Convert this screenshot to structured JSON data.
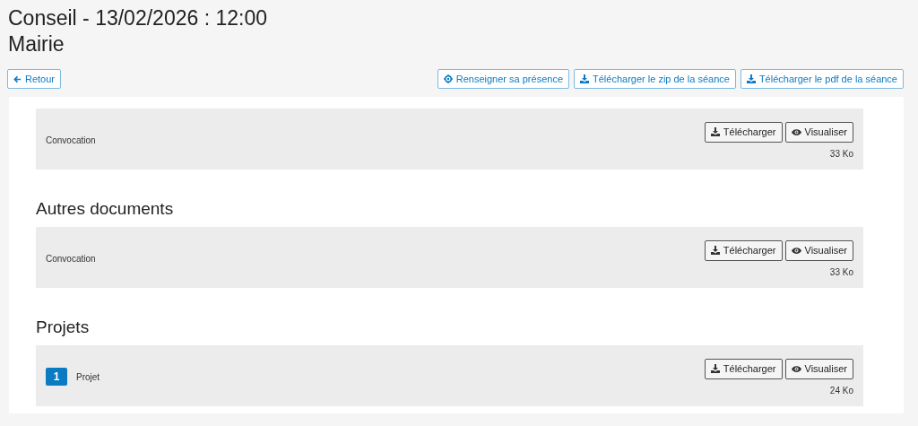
{
  "title": "Conseil - 13/02/2026 : 12:00",
  "subtitle": "Mairie",
  "back_button": "Retour",
  "actions": [
    {
      "kind": "presence",
      "label": "Renseigner sa présence"
    },
    {
      "kind": "download",
      "label": "Télécharger le zip de la séance"
    },
    {
      "kind": "download",
      "label": "Télécharger le pdf de la séance"
    }
  ],
  "sections": [
    {
      "documents": [
        {
          "name": "Convocation",
          "size": "33 Ko",
          "download": "Télécharger",
          "view": "Visualiser"
        }
      ]
    },
    {
      "heading": "Autres documents",
      "documents": [
        {
          "name": "Convocation",
          "size": "33 Ko",
          "download": "Télécharger",
          "view": "Visualiser"
        }
      ]
    },
    {
      "heading": "Projets",
      "documents": [
        {
          "number": "1",
          "name": "Projet",
          "size": "24 Ko",
          "download": "Télécharger",
          "view": "Visualiser"
        }
      ]
    }
  ]
}
